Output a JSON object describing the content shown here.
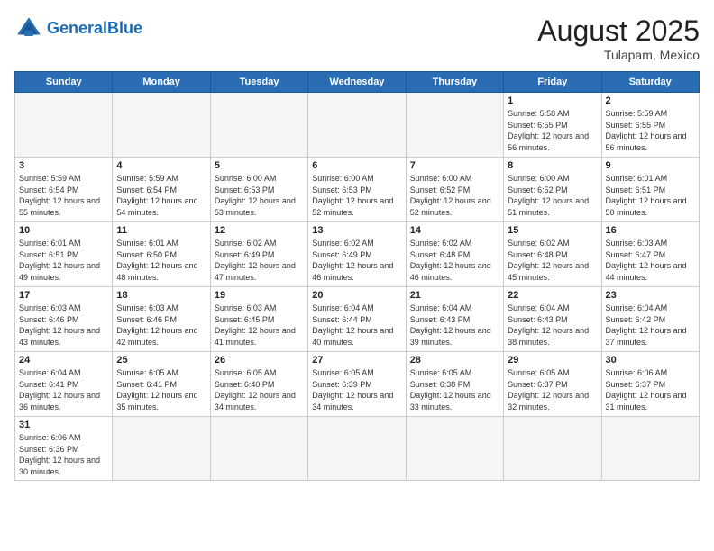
{
  "header": {
    "logo_general": "General",
    "logo_blue": "Blue",
    "month_year": "August 2025",
    "location": "Tulapam, Mexico"
  },
  "days_of_week": [
    "Sunday",
    "Monday",
    "Tuesday",
    "Wednesday",
    "Thursday",
    "Friday",
    "Saturday"
  ],
  "weeks": [
    [
      {
        "day": "",
        "info": "",
        "empty": true
      },
      {
        "day": "",
        "info": "",
        "empty": true
      },
      {
        "day": "",
        "info": "",
        "empty": true
      },
      {
        "day": "",
        "info": "",
        "empty": true
      },
      {
        "day": "",
        "info": "",
        "empty": true
      },
      {
        "day": "1",
        "info": "Sunrise: 5:58 AM\nSunset: 6:55 PM\nDaylight: 12 hours and 56 minutes."
      },
      {
        "day": "2",
        "info": "Sunrise: 5:59 AM\nSunset: 6:55 PM\nDaylight: 12 hours and 56 minutes."
      }
    ],
    [
      {
        "day": "3",
        "info": "Sunrise: 5:59 AM\nSunset: 6:54 PM\nDaylight: 12 hours and 55 minutes."
      },
      {
        "day": "4",
        "info": "Sunrise: 5:59 AM\nSunset: 6:54 PM\nDaylight: 12 hours and 54 minutes."
      },
      {
        "day": "5",
        "info": "Sunrise: 6:00 AM\nSunset: 6:53 PM\nDaylight: 12 hours and 53 minutes."
      },
      {
        "day": "6",
        "info": "Sunrise: 6:00 AM\nSunset: 6:53 PM\nDaylight: 12 hours and 52 minutes."
      },
      {
        "day": "7",
        "info": "Sunrise: 6:00 AM\nSunset: 6:52 PM\nDaylight: 12 hours and 52 minutes."
      },
      {
        "day": "8",
        "info": "Sunrise: 6:00 AM\nSunset: 6:52 PM\nDaylight: 12 hours and 51 minutes."
      },
      {
        "day": "9",
        "info": "Sunrise: 6:01 AM\nSunset: 6:51 PM\nDaylight: 12 hours and 50 minutes."
      }
    ],
    [
      {
        "day": "10",
        "info": "Sunrise: 6:01 AM\nSunset: 6:51 PM\nDaylight: 12 hours and 49 minutes."
      },
      {
        "day": "11",
        "info": "Sunrise: 6:01 AM\nSunset: 6:50 PM\nDaylight: 12 hours and 48 minutes."
      },
      {
        "day": "12",
        "info": "Sunrise: 6:02 AM\nSunset: 6:49 PM\nDaylight: 12 hours and 47 minutes."
      },
      {
        "day": "13",
        "info": "Sunrise: 6:02 AM\nSunset: 6:49 PM\nDaylight: 12 hours and 46 minutes."
      },
      {
        "day": "14",
        "info": "Sunrise: 6:02 AM\nSunset: 6:48 PM\nDaylight: 12 hours and 46 minutes."
      },
      {
        "day": "15",
        "info": "Sunrise: 6:02 AM\nSunset: 6:48 PM\nDaylight: 12 hours and 45 minutes."
      },
      {
        "day": "16",
        "info": "Sunrise: 6:03 AM\nSunset: 6:47 PM\nDaylight: 12 hours and 44 minutes."
      }
    ],
    [
      {
        "day": "17",
        "info": "Sunrise: 6:03 AM\nSunset: 6:46 PM\nDaylight: 12 hours and 43 minutes."
      },
      {
        "day": "18",
        "info": "Sunrise: 6:03 AM\nSunset: 6:46 PM\nDaylight: 12 hours and 42 minutes."
      },
      {
        "day": "19",
        "info": "Sunrise: 6:03 AM\nSunset: 6:45 PM\nDaylight: 12 hours and 41 minutes."
      },
      {
        "day": "20",
        "info": "Sunrise: 6:04 AM\nSunset: 6:44 PM\nDaylight: 12 hours and 40 minutes."
      },
      {
        "day": "21",
        "info": "Sunrise: 6:04 AM\nSunset: 6:43 PM\nDaylight: 12 hours and 39 minutes."
      },
      {
        "day": "22",
        "info": "Sunrise: 6:04 AM\nSunset: 6:43 PM\nDaylight: 12 hours and 38 minutes."
      },
      {
        "day": "23",
        "info": "Sunrise: 6:04 AM\nSunset: 6:42 PM\nDaylight: 12 hours and 37 minutes."
      }
    ],
    [
      {
        "day": "24",
        "info": "Sunrise: 6:04 AM\nSunset: 6:41 PM\nDaylight: 12 hours and 36 minutes."
      },
      {
        "day": "25",
        "info": "Sunrise: 6:05 AM\nSunset: 6:41 PM\nDaylight: 12 hours and 35 minutes."
      },
      {
        "day": "26",
        "info": "Sunrise: 6:05 AM\nSunset: 6:40 PM\nDaylight: 12 hours and 34 minutes."
      },
      {
        "day": "27",
        "info": "Sunrise: 6:05 AM\nSunset: 6:39 PM\nDaylight: 12 hours and 34 minutes."
      },
      {
        "day": "28",
        "info": "Sunrise: 6:05 AM\nSunset: 6:38 PM\nDaylight: 12 hours and 33 minutes."
      },
      {
        "day": "29",
        "info": "Sunrise: 6:05 AM\nSunset: 6:37 PM\nDaylight: 12 hours and 32 minutes."
      },
      {
        "day": "30",
        "info": "Sunrise: 6:06 AM\nSunset: 6:37 PM\nDaylight: 12 hours and 31 minutes."
      }
    ],
    [
      {
        "day": "31",
        "info": "Sunrise: 6:06 AM\nSunset: 6:36 PM\nDaylight: 12 hours and 30 minutes.",
        "last": true
      },
      {
        "day": "",
        "info": "",
        "empty": true,
        "last": true
      },
      {
        "day": "",
        "info": "",
        "empty": true,
        "last": true
      },
      {
        "day": "",
        "info": "",
        "empty": true,
        "last": true
      },
      {
        "day": "",
        "info": "",
        "empty": true,
        "last": true
      },
      {
        "day": "",
        "info": "",
        "empty": true,
        "last": true
      },
      {
        "day": "",
        "info": "",
        "empty": true,
        "last": true
      }
    ]
  ]
}
